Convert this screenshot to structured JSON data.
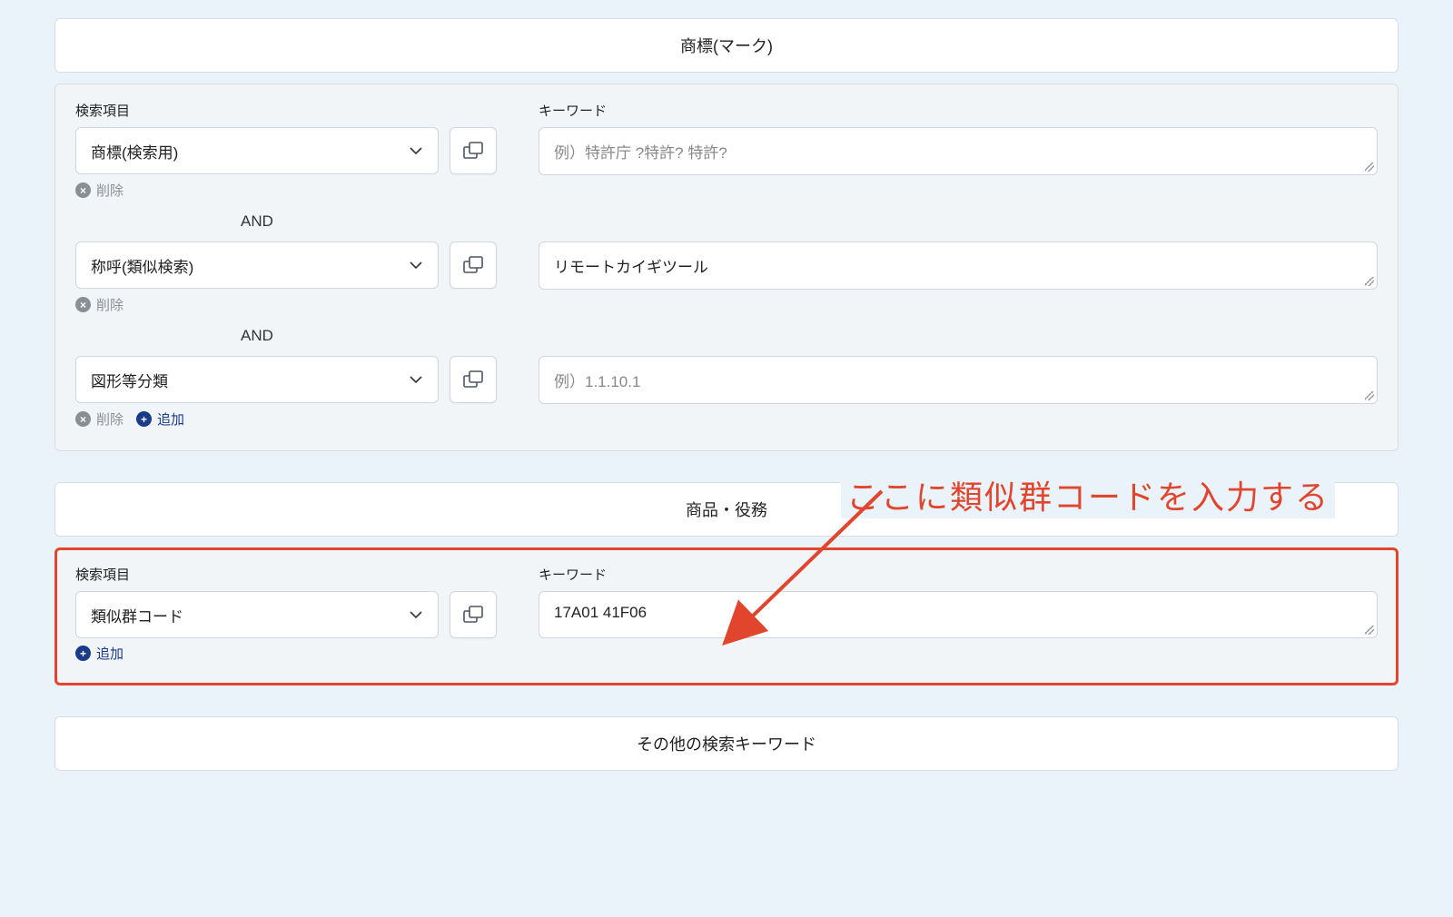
{
  "sections": {
    "trademark": {
      "title": "商標(マーク)",
      "col1_header": "検索項目",
      "col2_header": "キーワード",
      "and_label": "AND",
      "rows": [
        {
          "dropdown": "商標(検索用)",
          "value": "",
          "placeholder": "例）特許庁 ?特許? 特許?"
        },
        {
          "dropdown": "称呼(類似検索)",
          "value": "リモートカイギツール",
          "placeholder": ""
        },
        {
          "dropdown": "図形等分類",
          "value": "",
          "placeholder": "例）1.1.10.1"
        }
      ],
      "delete_label": "削除",
      "add_label": "追加"
    },
    "goods": {
      "title": "商品・役務",
      "col1_header": "検索項目",
      "col2_header": "キーワード",
      "rows": [
        {
          "dropdown": "類似群コード",
          "value": "17A01 41F06",
          "placeholder": ""
        }
      ],
      "add_label": "追加"
    },
    "other": {
      "title": "その他の検索キーワード"
    }
  },
  "annotation": {
    "text": "ここに類似群コードを入力する",
    "color": "#e2452d"
  }
}
